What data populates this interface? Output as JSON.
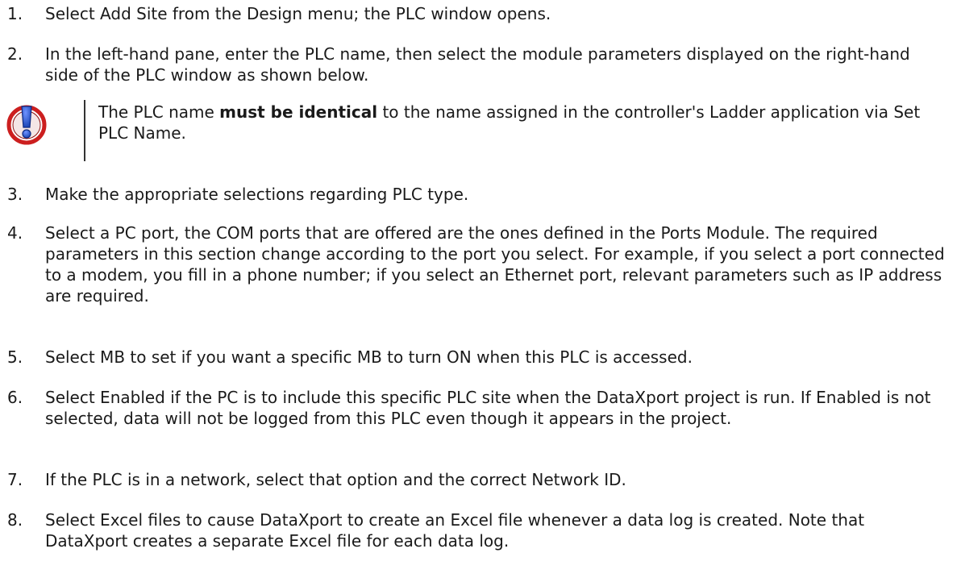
{
  "steps": [
    {
      "num": "1.",
      "text": "Select Add Site from the Design menu; the PLC window opens."
    },
    {
      "num": "2.",
      "text": "In the left-hand pane, enter the PLC name, then select the module parameters displayed on the right-hand side of the PLC window as shown below."
    },
    {
      "num": "3.",
      "text": "Make the appropriate selections regarding PLC type."
    },
    {
      "num": "4.",
      "text": "Select a PC port, the COM ports that are offered are the ones defined in the Ports Module. The required parameters in this section change according to the port you select. For example, if you select a port connected to a modem, you fill in a phone number; if you select an Ethernet port, relevant parameters such as IP address are required."
    },
    {
      "num": "5.",
      "text": "Select MB to set if you want a specific MB to turn ON when this PLC is accessed."
    },
    {
      "num": "6.",
      "text": "Select Enabled if the PC is to include this specific PLC site when the DataXport project is run.  If Enabled is not selected, data will not be logged from this PLC even though it appears in the project."
    },
    {
      "num": "7.",
      "text": "If the PLC is in a network, select that option and the correct Network ID."
    },
    {
      "num": "8.",
      "text": "Select Excel files to cause DataXport to create an Excel file whenever a data log is created. Note that DataXport creates a separate Excel file for each data log."
    }
  ],
  "note": {
    "icon": "important-icon",
    "text_before": "The PLC name ",
    "text_bold": "must be identical",
    "text_after": " to the name assigned in the controller's Ladder application via Set PLC Name."
  },
  "colors": {
    "icon_ring": "#cc1f1f",
    "icon_fill": "#1d47b8",
    "text": "#1a1a1a"
  }
}
